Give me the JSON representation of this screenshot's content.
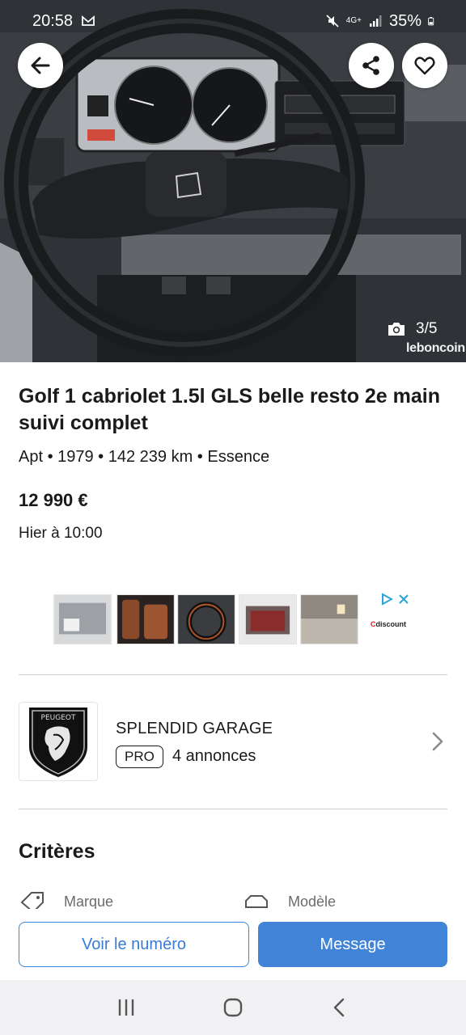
{
  "status_bar": {
    "time": "20:58",
    "battery": "35%",
    "network": "4G+",
    "icons": [
      "gmail-icon",
      "mute-icon",
      "signal-icon",
      "battery-icon"
    ]
  },
  "gallery": {
    "counter": "3/5",
    "watermark": "leboncoin",
    "icons": [
      "back-arrow-icon",
      "share-icon",
      "heart-icon",
      "camera-icon"
    ]
  },
  "listing": {
    "title": "Golf 1 cabriolet 1.5l GLS belle resto 2e main suivi complet",
    "specs": "Apt • 1979 • 142 239 km • Essence",
    "price": "12 990 €",
    "posted": "Hier à 10:00"
  },
  "ad_banner": {
    "brand_c": "C",
    "brand_rest": "discount",
    "icons": [
      "adchoices-icon",
      "close-icon"
    ]
  },
  "seller": {
    "logo_text": "PEUGEOT",
    "name": "SPLENDID GARAGE",
    "badge": "PRO",
    "ads_count": "4 annonces"
  },
  "criteria": {
    "title": "Critères",
    "items": [
      {
        "label": "Marque",
        "icon": "tag-icon"
      },
      {
        "label": "Modèle",
        "icon": "car-icon"
      }
    ]
  },
  "actions": {
    "call_label": "Voir le numéro",
    "message_label": "Message"
  },
  "colors": {
    "accent": "#4183d7",
    "text": "#1a1a1a",
    "divider": "#cfcfcf",
    "navbar": "#f1f1f3"
  }
}
